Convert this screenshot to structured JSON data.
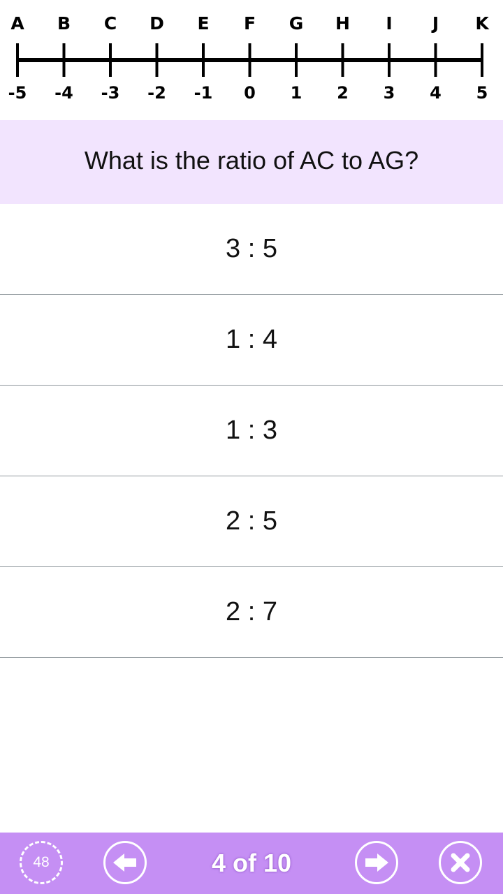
{
  "number_line": {
    "letters": [
      "A",
      "B",
      "C",
      "D",
      "E",
      "F",
      "G",
      "H",
      "I",
      "J",
      "K"
    ],
    "numbers": [
      "-5",
      "-4",
      "-3",
      "-2",
      "-1",
      "0",
      "1",
      "2",
      "3",
      "4",
      "5"
    ]
  },
  "question": {
    "text": "What is the ratio of AC to AG?"
  },
  "answers": [
    {
      "label": "3 : 5"
    },
    {
      "label": "1 : 4"
    },
    {
      "label": "1 : 3"
    },
    {
      "label": "2 : 5"
    },
    {
      "label": "2 : 7"
    }
  ],
  "bottom_bar": {
    "timer": "48",
    "page_counter": "4 of 10",
    "icons": {
      "timer": "stopwatch-icon",
      "prev": "arrow-left-icon",
      "next": "arrow-right-icon",
      "close": "close-icon"
    }
  },
  "colors": {
    "question_band": "#f2e4fe",
    "bottom_bar": "#c58ff4",
    "divider": "#8f979c"
  }
}
